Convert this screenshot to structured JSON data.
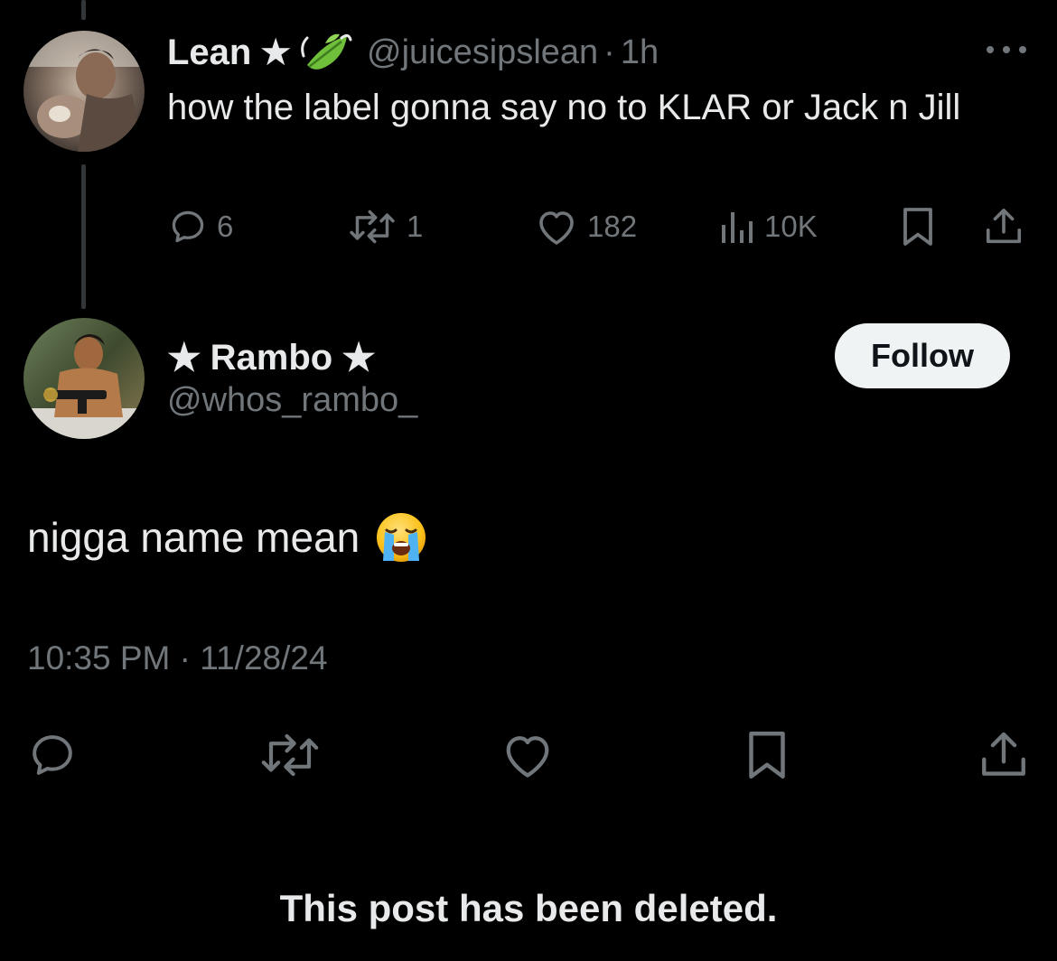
{
  "reply": {
    "display_name": "Lean",
    "handle": "@juicesipslean",
    "separator": "·",
    "time_ago": "1h",
    "text": "how the label gonna say no to KLAR or Jack n Jill",
    "stats": {
      "replies": "6",
      "reposts": "1",
      "likes": "182",
      "views": "10K"
    }
  },
  "post": {
    "display_name": "Rambo",
    "handle": "@whos_rambo_",
    "follow_label": "Follow",
    "text": "nigga name mean",
    "timestamp": "10:35 PM · 11/28/24"
  },
  "footer": {
    "deleted_notice": "This post has been deleted."
  },
  "icons": {
    "star": "★",
    "leaf": "leaf-icon",
    "emoji": "loudly-crying-face-icon"
  },
  "colors": {
    "background": "#000000",
    "text": "#e7e9ea",
    "muted": "#71767b",
    "thread_line": "#333639",
    "follow_bg": "#eff3f4"
  }
}
